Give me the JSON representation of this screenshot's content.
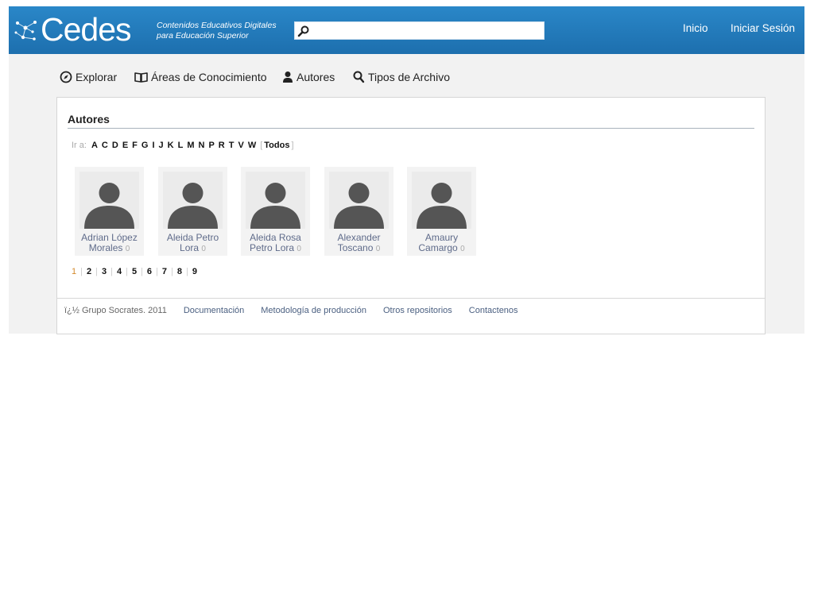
{
  "header": {
    "logo_text": "Cedes",
    "tagline_line1": "Contenidos Educativos Digitales",
    "tagline_line2": "para Educación Superior",
    "search": {
      "value": "",
      "placeholder": ""
    },
    "links": [
      "Inicio",
      "Iniciar Sesión"
    ]
  },
  "nav": {
    "items": [
      {
        "label": "Explorar",
        "icon": "compass-icon"
      },
      {
        "label": "Áreas de Conocimiento",
        "icon": "book-icon"
      },
      {
        "label": "Autores",
        "icon": "user-icon"
      },
      {
        "label": "Tipos de Archivo",
        "icon": "search-icon"
      }
    ]
  },
  "authors_section": {
    "title": "Autores",
    "goto_label": "Ir a:",
    "letters": [
      "A",
      "C",
      "D",
      "E",
      "F",
      "G",
      "I",
      "J",
      "K",
      "L",
      "M",
      "N",
      "P",
      "R",
      "T",
      "V",
      "W"
    ],
    "all_open": "[",
    "all_label": "Todos",
    "all_close": "]",
    "authors": [
      {
        "line1": "Adrian López",
        "line2": "Morales",
        "count": "0"
      },
      {
        "line1": "Aleida Petro",
        "line2": "Lora",
        "count": "0"
      },
      {
        "line1": "Aleida Rosa",
        "line2": "Petro Lora",
        "count": "0"
      },
      {
        "line1": "Alexander",
        "line2": "Toscano",
        "count": "0"
      },
      {
        "line1": "Amaury",
        "line2": "Camargo",
        "count": "0"
      }
    ],
    "pages": [
      "1",
      "2",
      "3",
      "4",
      "5",
      "6",
      "7",
      "8",
      "9"
    ],
    "current_page": "1"
  },
  "footer": {
    "copyright": "ï¿½ Grupo Socrates. 2011",
    "links": [
      "Documentación",
      "Metodología de producción",
      "Otros repositorios",
      "Contactenos"
    ]
  },
  "colors": {
    "header_blue": "#2a87c8",
    "nav_background": "#f2f2f2",
    "author_link": "#5f6b8a",
    "current_page": "#d48a2c"
  }
}
